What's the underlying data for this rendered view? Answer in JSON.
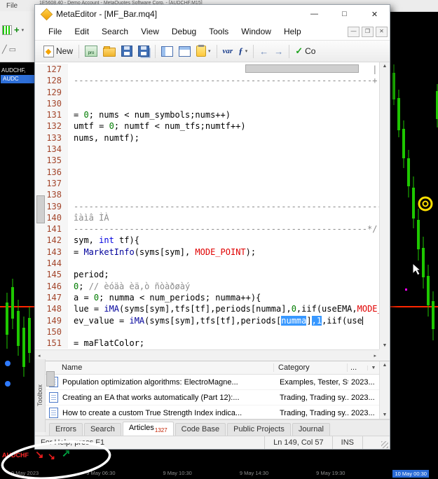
{
  "icons": {
    "minimize": "—",
    "maximize": "□",
    "close": "✕",
    "mdi_minimize": "—",
    "mdi_restore": "❐",
    "mdi_close": "✕",
    "dropdown": "▾",
    "check": "✓",
    "back": "←",
    "forward": "→",
    "up": "▲",
    "down": "▼",
    "left": "◂",
    "right": "▸",
    "sell_arrow": "↘",
    "buy_arrow": "↗",
    "pencil": "╱",
    "rect_tool": "▭",
    "plus": "+"
  },
  "mt4": {
    "title": "1E5608.40 - Demo Account - MetaQuotes Software Corp. - [AUDCHF,M15]",
    "menu_file": "File",
    "symbol_label": "AUDCHF,",
    "market_watch_selected": "AUDC",
    "bottom_symbol": "AUDCHF",
    "timestamps": [
      {
        "label": "9 May 2023"
      },
      {
        "label": "9 May 06:30"
      },
      {
        "label": "9 May 10:30"
      },
      {
        "label": "9 May 14:30"
      },
      {
        "label": "9 May 19:30"
      },
      {
        "label": "10 May 00:30",
        "highlight": true
      }
    ],
    "chart": {
      "bull_color": "#1ec800",
      "price_line_color": "#ff2600",
      "right_candles": [
        [
          560,
          92,
          104,
          142,
          150
        ],
        [
          567,
          128,
          140,
          186,
          196
        ],
        [
          574,
          172,
          184,
          226,
          240
        ],
        [
          581,
          214,
          226,
          266,
          282
        ],
        [
          588,
          252,
          268,
          312,
          326
        ],
        [
          595,
          298,
          314,
          356,
          372
        ],
        [
          602,
          338,
          354,
          396,
          412
        ],
        [
          609,
          378,
          394,
          436,
          452
        ],
        [
          616,
          416,
          430,
          470,
          486
        ],
        [
          622,
          120,
          130,
          170,
          182
        ]
      ],
      "left_candles": [
        [
          8,
          418,
          432,
          478,
          498
        ],
        [
          16,
          398,
          410,
          455,
          470
        ],
        [
          24,
          428,
          444,
          494,
          508
        ],
        [
          32,
          452,
          468,
          524,
          538
        ],
        [
          40,
          438,
          454,
          504,
          518
        ]
      ],
      "blue_dots": [
        [
          11,
          519
        ],
        [
          11,
          548
        ]
      ],
      "magenta_dot": [
        578,
        412
      ]
    }
  },
  "editor": {
    "window_title": "MetaEditor - [MF_Bar.mq4]",
    "menu": [
      "File",
      "Edit",
      "Search",
      "View",
      "Debug",
      "Tools",
      "Window",
      "Help"
    ],
    "toolbar": {
      "new_label": "New",
      "profiler_label": "pro",
      "var_label": "var",
      "fx_label": "ƒ",
      "compile_label": "Co"
    },
    "code": {
      "lines": [
        {
          "n": 127,
          "s": [
            {
              "t": "                                                           |",
              "c": "c"
            }
          ]
        },
        {
          "n": 128,
          "s": [
            {
              "t": "-----------------------------------------------------------+",
              "c": "c"
            }
          ]
        },
        {
          "n": 129,
          "s": []
        },
        {
          "n": 130,
          "s": []
        },
        {
          "n": 131,
          "s": [
            {
              "t": "= "
            },
            {
              "t": "0",
              "c": "n"
            },
            {
              "t": "; nums < num_symbols;nums++)"
            }
          ]
        },
        {
          "n": 132,
          "s": [
            {
              "t": "umtf = "
            },
            {
              "t": "0",
              "c": "n"
            },
            {
              "t": "; numtf < num_tfs;numtf++)"
            }
          ]
        },
        {
          "n": 133,
          "s": [
            {
              "t": "nums, numtf);"
            }
          ]
        },
        {
          "n": 134,
          "s": []
        },
        {
          "n": 135,
          "s": []
        },
        {
          "n": 136,
          "s": []
        },
        {
          "n": 137,
          "s": []
        },
        {
          "n": 138,
          "s": []
        },
        {
          "n": 139,
          "s": [
            {
              "t": "--------------------------------------------------------------",
              "c": "c"
            }
          ]
        },
        {
          "n": 140,
          "s": [
            {
              "t": "îàìâ ÌÀ",
              "c": "c"
            }
          ]
        },
        {
          "n": 141,
          "s": [
            {
              "t": "----------------------------------------------------------*/",
              "c": "c"
            }
          ]
        },
        {
          "n": 142,
          "s": [
            {
              "t": "sym, "
            },
            {
              "t": "int",
              "c": "k"
            },
            {
              "t": " tf){"
            }
          ]
        },
        {
          "n": 143,
          "s": [
            {
              "t": "= "
            },
            {
              "t": "MarketInfo",
              "c": "f"
            },
            {
              "t": "(syms[sym], "
            },
            {
              "t": "MODE_POINT",
              "c": "r"
            },
            {
              "t": ");"
            }
          ]
        },
        {
          "n": 144,
          "s": []
        },
        {
          "n": 145,
          "s": [
            {
              "t": "period;"
            }
          ]
        },
        {
          "n": 146,
          "s": [
            {
              "t": "0",
              "c": "n"
            },
            {
              "t": "; "
            },
            {
              "t": "// èóäà èä,ò ñòàðøàý",
              "c": "c"
            }
          ]
        },
        {
          "n": 147,
          "s": [
            {
              "t": "a = "
            },
            {
              "t": "0",
              "c": "n"
            },
            {
              "t": "; numma < num_periods; numma++){"
            }
          ]
        },
        {
          "n": 148,
          "s": [
            {
              "t": "lue = "
            },
            {
              "t": "iMA",
              "c": "f"
            },
            {
              "t": "(syms[sym],tfs[tf],periods[numma],"
            },
            {
              "t": "0",
              "c": "n"
            },
            {
              "t": ",iif(useEMA,"
            },
            {
              "t": "MODE_E",
              "c": "r"
            }
          ]
        },
        {
          "n": 149,
          "s": [
            {
              "t": "ev_value = "
            },
            {
              "t": "iMA",
              "c": "f"
            },
            {
              "t": "(syms[sym],tfs[tf],periods["
            },
            {
              "t": "numma",
              "c": "sel"
            },
            {
              "t": "]"
            },
            {
              "t": ",1",
              "c": "sel"
            },
            {
              "t": ",iif(use"
            },
            {
              "t": "",
              "c": "caret"
            }
          ]
        },
        {
          "n": 150,
          "s": []
        },
        {
          "n": 151,
          "s": [
            {
              "t": "= maFlatColor;"
            }
          ]
        }
      ]
    }
  },
  "toolbox": {
    "side_label": "Toolbox",
    "columns": {
      "name": "Name",
      "category": "Category",
      "date": "..."
    },
    "rows": [
      {
        "name": "Population optimization algorithms: ElectroMagne...",
        "category": "Examples, Tester, St...",
        "date": "2023..."
      },
      {
        "name": "Creating an EA that works automatically (Part 12):...",
        "category": "Trading, Trading sy...",
        "date": "2023..."
      },
      {
        "name": "How to create a custom True Strength Index indica...",
        "category": "Trading, Trading sy...",
        "date": "2023..."
      }
    ],
    "tabs": [
      {
        "label": "Errors"
      },
      {
        "label": "Search"
      },
      {
        "label": "Articles",
        "badge": "1327",
        "active": true
      },
      {
        "label": "Code Base"
      },
      {
        "label": "Public Projects"
      },
      {
        "label": "Journal"
      }
    ]
  },
  "statusbar": {
    "help": "For Help, press F1",
    "position": "Ln 149, Col 57",
    "mode": "INS"
  }
}
